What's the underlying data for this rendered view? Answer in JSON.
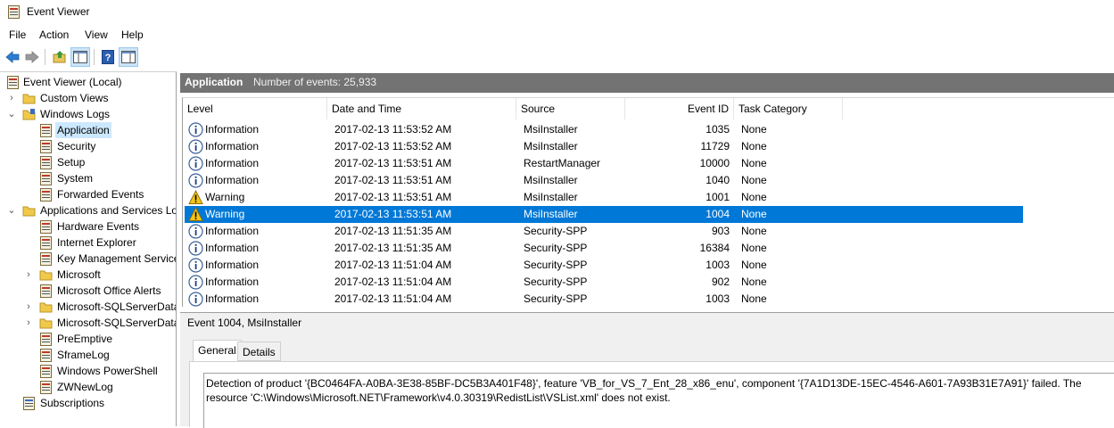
{
  "window": {
    "title": "Event Viewer"
  },
  "menu": {
    "file": "File",
    "action": "Action",
    "view": "View",
    "help": "Help"
  },
  "toolbar": {
    "buttons": [
      "back-arrow-icon",
      "forward-arrow-icon",
      "folder-up-icon",
      "show-hide-tree-icon",
      "help-icon",
      "show-hide-action-pane-icon"
    ]
  },
  "tree": {
    "root": "Event Viewer (Local)",
    "custom_views": "Custom Views",
    "windows_logs": "Windows Logs",
    "application": "Application",
    "security": "Security",
    "setup": "Setup",
    "system": "System",
    "forwarded": "Forwarded Events",
    "apps_services": "Applications and Services Lo",
    "hardware_events": "Hardware Events",
    "internet_explorer": "Internet Explorer",
    "key_management": "Key Management Service",
    "microsoft": "Microsoft",
    "office_alerts": "Microsoft Office Alerts",
    "sql_1": "Microsoft-SQLServerData",
    "sql_2": "Microsoft-SQLServerData",
    "preemptive": "PreEmptive",
    "sframelog": "SframeLog",
    "powershell": "Windows PowerShell",
    "zwnewlog": "ZWNewLog",
    "subscriptions": "Subscriptions"
  },
  "header": {
    "title": "Application",
    "count": "Number of events: 25,933"
  },
  "columns": {
    "level": "Level",
    "date": "Date and Time",
    "source": "Source",
    "event_id": "Event ID",
    "task": "Task Category"
  },
  "rows": [
    {
      "level": "Information",
      "icon": "info",
      "date": "2017-02-13 11:53:52 AM",
      "source": "MsiInstaller",
      "id": "1035",
      "task": "None"
    },
    {
      "level": "Information",
      "icon": "info",
      "date": "2017-02-13 11:53:52 AM",
      "source": "MsiInstaller",
      "id": "11729",
      "task": "None"
    },
    {
      "level": "Information",
      "icon": "info",
      "date": "2017-02-13 11:53:51 AM",
      "source": "RestartManager",
      "id": "10000",
      "task": "None"
    },
    {
      "level": "Information",
      "icon": "info",
      "date": "2017-02-13 11:53:51 AM",
      "source": "MsiInstaller",
      "id": "1040",
      "task": "None"
    },
    {
      "level": "Warning",
      "icon": "warning",
      "date": "2017-02-13 11:53:51 AM",
      "source": "MsiInstaller",
      "id": "1001",
      "task": "None"
    },
    {
      "level": "Warning",
      "icon": "warning",
      "date": "2017-02-13 11:53:51 AM",
      "source": "MsiInstaller",
      "id": "1004",
      "task": "None",
      "selected": true
    },
    {
      "level": "Information",
      "icon": "info",
      "date": "2017-02-13 11:51:35 AM",
      "source": "Security-SPP",
      "id": "903",
      "task": "None"
    },
    {
      "level": "Information",
      "icon": "info",
      "date": "2017-02-13 11:51:35 AM",
      "source": "Security-SPP",
      "id": "16384",
      "task": "None"
    },
    {
      "level": "Information",
      "icon": "info",
      "date": "2017-02-13 11:51:04 AM",
      "source": "Security-SPP",
      "id": "1003",
      "task": "None"
    },
    {
      "level": "Information",
      "icon": "info",
      "date": "2017-02-13 11:51:04 AM",
      "source": "Security-SPP",
      "id": "902",
      "task": "None"
    },
    {
      "level": "Information",
      "icon": "info",
      "date": "2017-02-13 11:51:04 AM",
      "source": "Security-SPP",
      "id": "1003",
      "task": "None"
    }
  ],
  "detail": {
    "title": "Event 1004, MsiInstaller",
    "tab_general": "General",
    "tab_details": "Details",
    "text": "Detection of product '{BC0464FA-A0BA-3E38-85BF-DC5B3A401F48}', feature 'VB_for_VS_7_Ent_28_x86_enu', component '{7A1D13DE-15EC-4546-A601-7A93B31E7A91}' failed.  The resource 'C:\\Windows\\Microsoft.NET\\Framework\\v4.0.30319\\RedistList\\VSList.xml' does not exist."
  },
  "colors": {
    "selection": "#0078d7",
    "tree_selection": "#cce8ff",
    "header_bar": "#737373"
  }
}
